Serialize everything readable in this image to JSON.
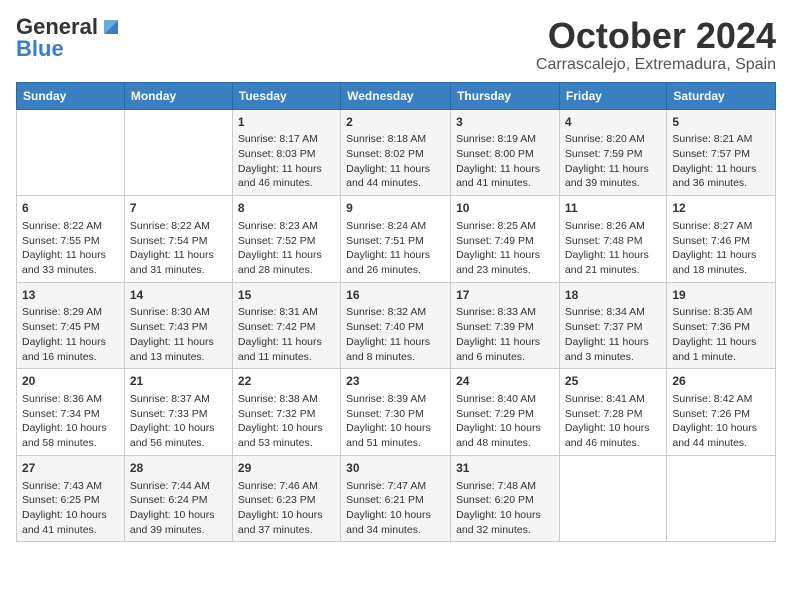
{
  "header": {
    "logo_general": "General",
    "logo_blue": "Blue",
    "month": "October 2024",
    "location": "Carrascalejo, Extremadura, Spain"
  },
  "days_of_week": [
    "Sunday",
    "Monday",
    "Tuesday",
    "Wednesday",
    "Thursday",
    "Friday",
    "Saturday"
  ],
  "weeks": [
    [
      {
        "day": "",
        "content": ""
      },
      {
        "day": "",
        "content": ""
      },
      {
        "day": "1",
        "content": "Sunrise: 8:17 AM\nSunset: 8:03 PM\nDaylight: 11 hours and 46 minutes."
      },
      {
        "day": "2",
        "content": "Sunrise: 8:18 AM\nSunset: 8:02 PM\nDaylight: 11 hours and 44 minutes."
      },
      {
        "day": "3",
        "content": "Sunrise: 8:19 AM\nSunset: 8:00 PM\nDaylight: 11 hours and 41 minutes."
      },
      {
        "day": "4",
        "content": "Sunrise: 8:20 AM\nSunset: 7:59 PM\nDaylight: 11 hours and 39 minutes."
      },
      {
        "day": "5",
        "content": "Sunrise: 8:21 AM\nSunset: 7:57 PM\nDaylight: 11 hours and 36 minutes."
      }
    ],
    [
      {
        "day": "6",
        "content": "Sunrise: 8:22 AM\nSunset: 7:55 PM\nDaylight: 11 hours and 33 minutes."
      },
      {
        "day": "7",
        "content": "Sunrise: 8:22 AM\nSunset: 7:54 PM\nDaylight: 11 hours and 31 minutes."
      },
      {
        "day": "8",
        "content": "Sunrise: 8:23 AM\nSunset: 7:52 PM\nDaylight: 11 hours and 28 minutes."
      },
      {
        "day": "9",
        "content": "Sunrise: 8:24 AM\nSunset: 7:51 PM\nDaylight: 11 hours and 26 minutes."
      },
      {
        "day": "10",
        "content": "Sunrise: 8:25 AM\nSunset: 7:49 PM\nDaylight: 11 hours and 23 minutes."
      },
      {
        "day": "11",
        "content": "Sunrise: 8:26 AM\nSunset: 7:48 PM\nDaylight: 11 hours and 21 minutes."
      },
      {
        "day": "12",
        "content": "Sunrise: 8:27 AM\nSunset: 7:46 PM\nDaylight: 11 hours and 18 minutes."
      }
    ],
    [
      {
        "day": "13",
        "content": "Sunrise: 8:29 AM\nSunset: 7:45 PM\nDaylight: 11 hours and 16 minutes."
      },
      {
        "day": "14",
        "content": "Sunrise: 8:30 AM\nSunset: 7:43 PM\nDaylight: 11 hours and 13 minutes."
      },
      {
        "day": "15",
        "content": "Sunrise: 8:31 AM\nSunset: 7:42 PM\nDaylight: 11 hours and 11 minutes."
      },
      {
        "day": "16",
        "content": "Sunrise: 8:32 AM\nSunset: 7:40 PM\nDaylight: 11 hours and 8 minutes."
      },
      {
        "day": "17",
        "content": "Sunrise: 8:33 AM\nSunset: 7:39 PM\nDaylight: 11 hours and 6 minutes."
      },
      {
        "day": "18",
        "content": "Sunrise: 8:34 AM\nSunset: 7:37 PM\nDaylight: 11 hours and 3 minutes."
      },
      {
        "day": "19",
        "content": "Sunrise: 8:35 AM\nSunset: 7:36 PM\nDaylight: 11 hours and 1 minute."
      }
    ],
    [
      {
        "day": "20",
        "content": "Sunrise: 8:36 AM\nSunset: 7:34 PM\nDaylight: 10 hours and 58 minutes."
      },
      {
        "day": "21",
        "content": "Sunrise: 8:37 AM\nSunset: 7:33 PM\nDaylight: 10 hours and 56 minutes."
      },
      {
        "day": "22",
        "content": "Sunrise: 8:38 AM\nSunset: 7:32 PM\nDaylight: 10 hours and 53 minutes."
      },
      {
        "day": "23",
        "content": "Sunrise: 8:39 AM\nSunset: 7:30 PM\nDaylight: 10 hours and 51 minutes."
      },
      {
        "day": "24",
        "content": "Sunrise: 8:40 AM\nSunset: 7:29 PM\nDaylight: 10 hours and 48 minutes."
      },
      {
        "day": "25",
        "content": "Sunrise: 8:41 AM\nSunset: 7:28 PM\nDaylight: 10 hours and 46 minutes."
      },
      {
        "day": "26",
        "content": "Sunrise: 8:42 AM\nSunset: 7:26 PM\nDaylight: 10 hours and 44 minutes."
      }
    ],
    [
      {
        "day": "27",
        "content": "Sunrise: 7:43 AM\nSunset: 6:25 PM\nDaylight: 10 hours and 41 minutes."
      },
      {
        "day": "28",
        "content": "Sunrise: 7:44 AM\nSunset: 6:24 PM\nDaylight: 10 hours and 39 minutes."
      },
      {
        "day": "29",
        "content": "Sunrise: 7:46 AM\nSunset: 6:23 PM\nDaylight: 10 hours and 37 minutes."
      },
      {
        "day": "30",
        "content": "Sunrise: 7:47 AM\nSunset: 6:21 PM\nDaylight: 10 hours and 34 minutes."
      },
      {
        "day": "31",
        "content": "Sunrise: 7:48 AM\nSunset: 6:20 PM\nDaylight: 10 hours and 32 minutes."
      },
      {
        "day": "",
        "content": ""
      },
      {
        "day": "",
        "content": ""
      }
    ]
  ]
}
